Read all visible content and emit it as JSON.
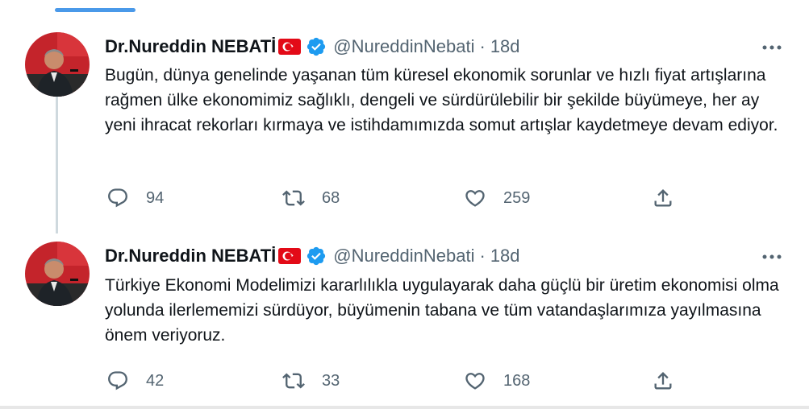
{
  "tweets": [
    {
      "author_name": "Dr.Nureddin NEBATİ",
      "handle": "@NureddinNebati",
      "separator": "·",
      "time": "18d",
      "text": "Bugün, dünya genelinde yaşanan tüm küresel ekonomik sorunlar ve hızlı fiyat artışlarına rağmen ülke ekonomimiz sağlıklı, dengeli ve sürdürülebilir bir şekilde büyümeye, her ay yeni ihracat rekorları kırmaya ve istihdamımızda somut artışlar kaydetmeye devam ediyor.",
      "replies": "94",
      "retweets": "68",
      "likes": "259"
    },
    {
      "author_name": "Dr.Nureddin NEBATİ",
      "handle": "@NureddinNebati",
      "separator": "·",
      "time": "18d",
      "text": "Türkiye Ekonomi Modelimizi kararlılıkla uygulayarak daha güçlü bir üretim ekonomisi olma yolunda ilerlememizi sürdüyor, büyümenin tabana ve tüm vatandaşlarımıza yayılmasına önem veriyoruz.",
      "replies": "42",
      "retweets": "33",
      "likes": "168"
    }
  ],
  "icons": {
    "flag": "turkey-flag-icon",
    "verified": "verified-badge-icon",
    "more": "more-options-icon",
    "reply": "reply-icon",
    "retweet": "retweet-icon",
    "like": "like-heart-icon",
    "share": "share-icon"
  },
  "colors": {
    "accent": "#1d9bf0",
    "text": "#0f1419",
    "secondary": "#536471",
    "thread_line": "#cfd9de",
    "flag_red": "#e30a17"
  }
}
